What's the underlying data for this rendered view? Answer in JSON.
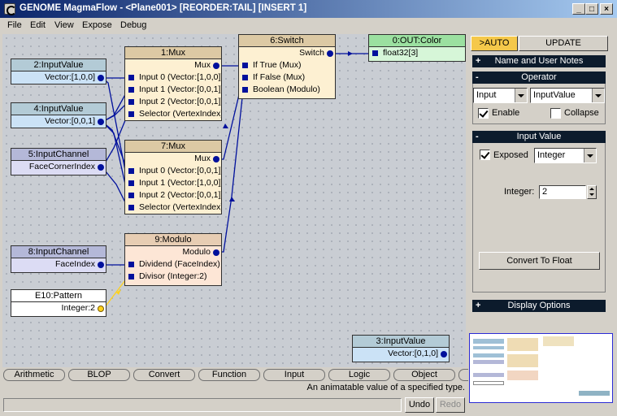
{
  "window": {
    "title": "GENOME MagmaFlow - <Plane001> [REORDER:TAIL] [INSERT 1]",
    "minimize_glyph": "_",
    "maximize_glyph": "□",
    "close_glyph": "×"
  },
  "menu": [
    "File",
    "Edit",
    "View",
    "Expose",
    "Debug"
  ],
  "nodes": {
    "n2": {
      "title": "2:InputValue",
      "out": "Vector:[1,0,0]"
    },
    "n4": {
      "title": "4:InputValue",
      "out": "Vector:[0,0,1]"
    },
    "n5": {
      "title": "5:InputChannel",
      "out": "FaceCornerIndex"
    },
    "n8": {
      "title": "8:InputChannel",
      "out": "FaceIndex"
    },
    "n10": {
      "title": "E10:Pattern",
      "out": "Integer:2"
    },
    "n1": {
      "title": "1:Mux",
      "out": "Mux",
      "inputs": [
        "Input 0 (Vector:[1,0,0])",
        "Input 1 (Vector:[0,0,1])",
        "Input 2 (Vector:[0,0,1])",
        "Selector (VertexIndex)"
      ]
    },
    "n7": {
      "title": "7:Mux",
      "out": "Mux",
      "inputs": [
        "Input 0 (Vector:[0,0,1])",
        "Input 1 (Vector:[1,0,0])",
        "Input 2 (Vector:[0,0,1])",
        "Selector (VertexIndex)"
      ]
    },
    "n9": {
      "title": "9:Modulo",
      "out": "Modulo",
      "inputs": [
        "Dividend (FaceIndex)",
        "Divisor (Integer:2)"
      ]
    },
    "n6": {
      "title": "6:Switch",
      "out": "Switch",
      "inputs": [
        "If True (Mux)",
        "If False (Mux)",
        "Boolean (Modulo)"
      ]
    },
    "n0": {
      "title": "0:OUT:Color",
      "inputs": [
        "float32[3]"
      ]
    },
    "n3": {
      "title": "3:InputValue",
      "out": "Vector:[0,1,0]"
    }
  },
  "panel": {
    "auto_tab": ">AUTO",
    "update_tab": "UPDATE",
    "name_notes": {
      "sign": "+",
      "label": "Name and User Notes"
    },
    "operator": {
      "sign": "-",
      "label": "Operator",
      "category": "Input",
      "type": "InputValue",
      "enable_label": "Enable",
      "collapse_label": "Collapse"
    },
    "input_value": {
      "sign": "-",
      "label": "Input Value",
      "exposed_label": "Exposed",
      "type": "Integer",
      "integer_label": "Integer:",
      "integer_value": "2",
      "convert_button": "Convert To Float"
    },
    "display_options": {
      "sign": "+",
      "label": "Display Options"
    }
  },
  "palette": [
    "Arithmetic",
    "BLOP",
    "Convert",
    "Function",
    "Input",
    "Logic",
    "Object"
  ],
  "status_text": "An animatable value of a specified type.",
  "undo_label": "Undo",
  "redo_label": "Redo",
  "colors": {
    "accent_tab": "#f5c84a",
    "wire": "#00109c",
    "wire_yellow": "#ffd21c",
    "section_header": "#0c1b2c"
  }
}
